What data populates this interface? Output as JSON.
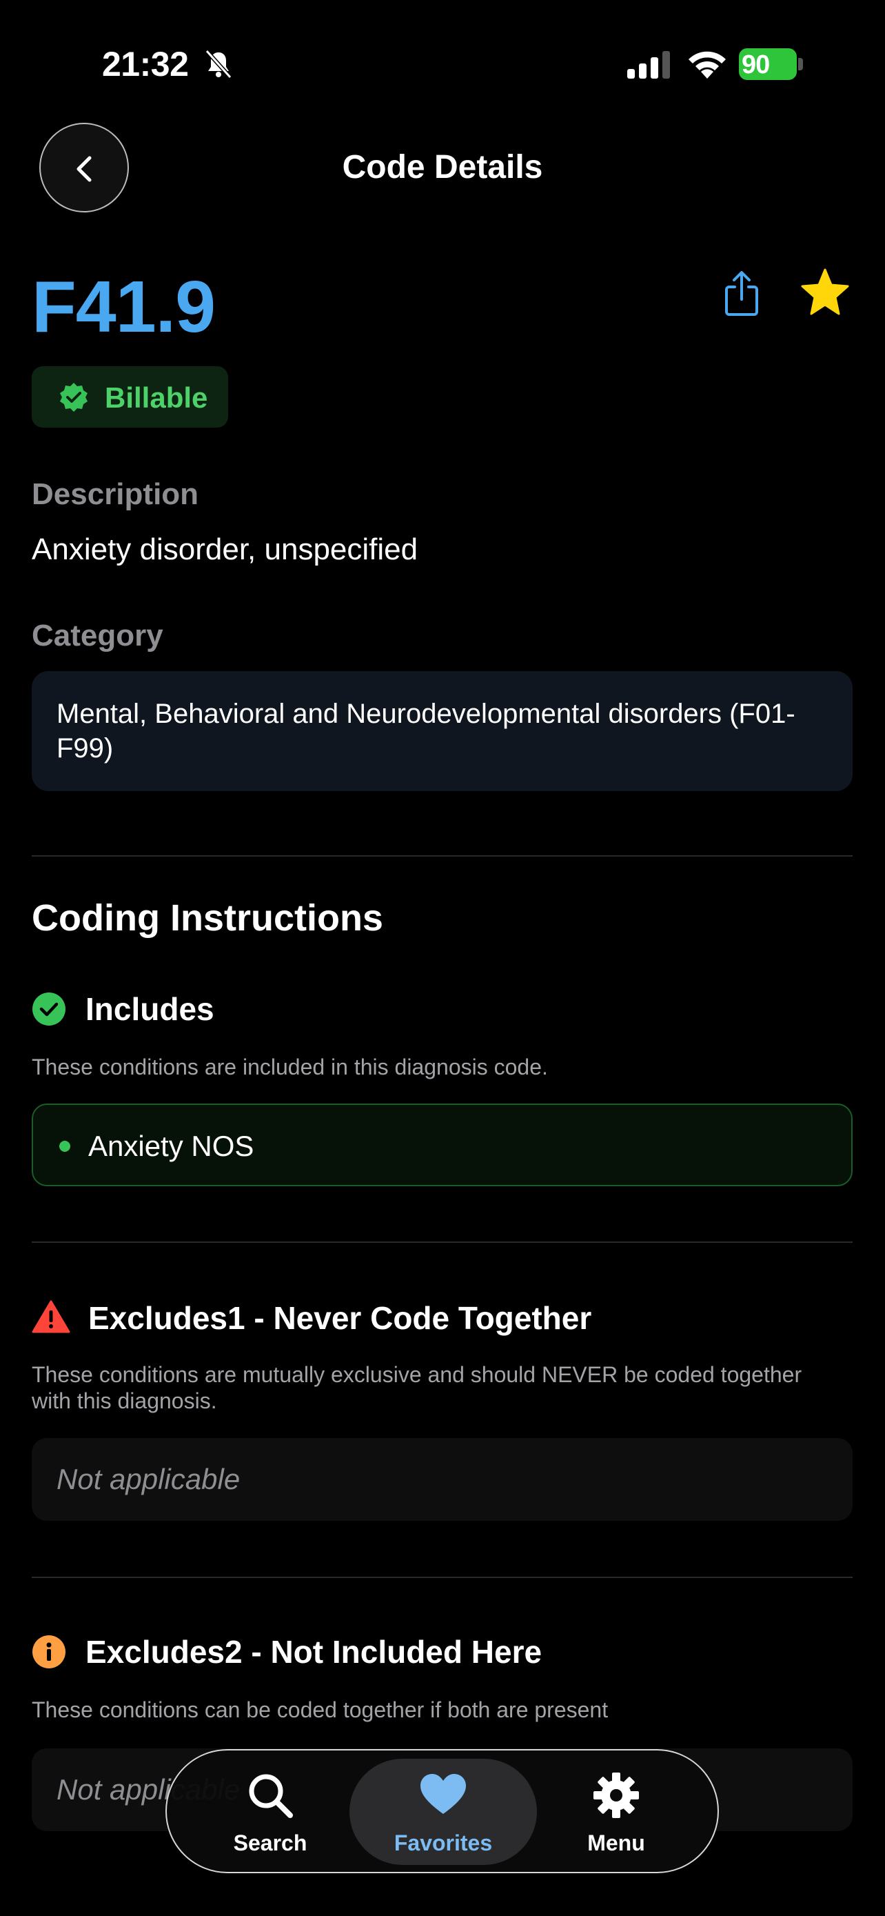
{
  "status_bar": {
    "time": "21:32",
    "battery": "90"
  },
  "nav": {
    "title": "Code Details"
  },
  "code": {
    "value": "F41.9",
    "badge": "Billable",
    "description_label": "Description",
    "description": "Anxiety disorder, unspecified",
    "category_label": "Category",
    "category": "Mental, Behavioral and Neurodevelopmental disorders (F01-F99)"
  },
  "coding_instructions": {
    "title": "Coding Instructions",
    "includes": {
      "title": "Includes",
      "description": "These conditions are included in this diagnosis code.",
      "items": [
        "Anxiety NOS"
      ]
    },
    "excludes1": {
      "title": "Excludes1 - Never Code Together",
      "description": "These conditions are mutually exclusive and should NEVER be coded together with this diagnosis.",
      "value": "Not applicable"
    },
    "excludes2": {
      "title": "Excludes2 - Not Included Here",
      "description": "These conditions can be coded together if both are present",
      "value": "Not applicable"
    }
  },
  "tab_bar": {
    "items": [
      {
        "label": "Search",
        "icon": "search-icon"
      },
      {
        "label": "Favorites",
        "icon": "heart-icon",
        "selected": true
      },
      {
        "label": "Menu",
        "icon": "gear-icon"
      }
    ]
  },
  "colors": {
    "accent": "#4aa8f0",
    "billable_green": "#4cd268",
    "star": "#ffd60a",
    "warning_red": "#ff453a",
    "info_orange": "#ff9f43"
  }
}
